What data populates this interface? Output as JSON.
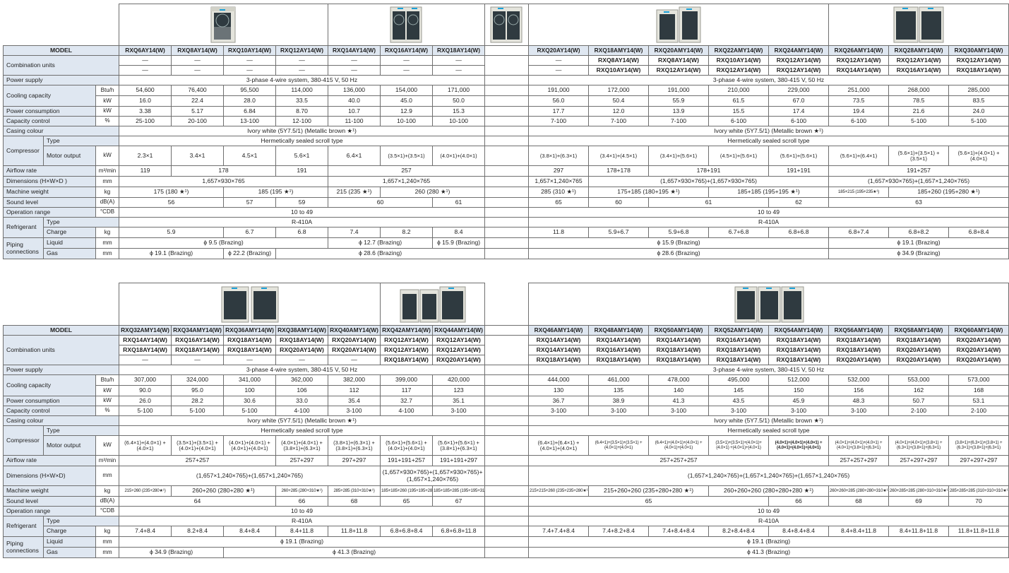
{
  "t1": {
    "models": [
      "RXQ6AY14(W)",
      "RXQ8AY14(W)",
      "RXQ10AY14(W)",
      "RXQ12AY14(W)",
      "RXQ14AY14(W)",
      "RXQ16AY14(W)",
      "RXQ18AY14(W)",
      "RXQ20AY14(W)",
      "RXQ18AMY14(W)",
      "RXQ20AMY14(W)",
      "RXQ22AMY14(W)",
      "RXQ24AMY14(W)",
      "RXQ26AMY14(W)",
      "RXQ28AMY14(W)",
      "RXQ30AMY14(W)"
    ],
    "comb1": [
      "—",
      "—",
      "—",
      "—",
      "—",
      "—",
      "—",
      "—",
      "RXQ8AY14(W)",
      "RXQ8AY14(W)",
      "RXQ10AY14(W)",
      "RXQ12AY14(W)",
      "RXQ12AY14(W)",
      "RXQ12AY14(W)",
      "RXQ12AY14(W)"
    ],
    "comb2": [
      "—",
      "—",
      "—",
      "—",
      "—",
      "—",
      "—",
      "—",
      "RXQ10AY14(W)",
      "RXQ12AY14(W)",
      "RXQ12AY14(W)",
      "RXQ12AY14(W)",
      "RXQ14AY14(W)",
      "RXQ16AY14(W)",
      "RXQ18AY14(W)"
    ],
    "power_supply_left": "3-phase 4-wire system, 380-415 V, 50 Hz",
    "power_supply_right": "3-phase 4-wire system, 380-415 V, 50 Hz",
    "cool_btu": [
      "54,600",
      "76,400",
      "95,500",
      "114,000",
      "136,000",
      "154,000",
      "171,000",
      "191,000",
      "172,000",
      "191,000",
      "210,000",
      "229,000",
      "251,000",
      "268,000",
      "285,000"
    ],
    "cool_kw": [
      "16.0",
      "22.4",
      "28.0",
      "33.5",
      "40.0",
      "45.0",
      "50.0",
      "56.0",
      "50.4",
      "55.9",
      "61.5",
      "67.0",
      "73.5",
      "78.5",
      "83.5"
    ],
    "power_kw": [
      "3.38",
      "5.17",
      "6.84",
      "8.70",
      "10.7",
      "12.9",
      "15.3",
      "17.7",
      "12.0",
      "13.9",
      "15.5",
      "17.4",
      "19.4",
      "21.6",
      "24.0"
    ],
    "capacity": [
      "25-100",
      "20-100",
      "13-100",
      "12-100",
      "11-100",
      "10-100",
      "10-100",
      "7-100",
      "7-100",
      "7-100",
      "6-100",
      "6-100",
      "6-100",
      "5-100",
      "5-100"
    ],
    "casing_left": "Ivory white (5Y7.5/1) (Metallic brown ★¹)",
    "casing_right": "Ivory white (5Y7.5/1) (Metallic brown ★¹)",
    "comp_type_left": "Hermetically sealed scroll type",
    "comp_type_right": "Hermetically sealed scroll type",
    "motor": [
      "2.3×1",
      "3.4×1",
      "4.5×1",
      "5.6×1",
      "6.4×1",
      "(3.5×1)+(3.5×1)",
      "(4.0×1)+(4.0×1)",
      "(3.8×1)+(6.3×1)",
      "(3.4×1)+(4.5×1)",
      "(3.4×1)+(5.6×1)",
      "(4.5×1)+(5.6×1)",
      "(5.6×1)+(5.6×1)",
      "(5.6×1)+(6.4×1)",
      "(5.6×1)+(3.5×1) +(3.5×1)",
      "(5.6×1)+(4.0×1) +(4.0×1)"
    ],
    "airflow": [
      "119",
      "178",
      "191",
      "257",
      "297",
      "178+178",
      "178+191",
      "191+191",
      "191+257"
    ],
    "dims": [
      "1,657×930×765",
      "1,657×1,240×765",
      "1,657×1,240×765",
      "(1,657×930×765)+(1,657×930×765)",
      "(1,657×930×765)+(1,657×1,240×765)"
    ],
    "weight": [
      "175 (180 ★¹)",
      "185 (195 ★¹)",
      "215 (235 ★¹)",
      "260 (280 ★¹)",
      "285 (310 ★¹)",
      "175+185 (180+195 ★¹)",
      "185+185 (195+195 ★¹)",
      "185+215 (195+235★¹)",
      "185+260 (195+280 ★¹)"
    ],
    "sound": [
      "56",
      "57",
      "59",
      "60",
      "61",
      "65",
      "60",
      "61",
      "62",
      "63"
    ],
    "op_left": "10 to 49",
    "op_right": "10 to 49",
    "ref_type_left": "R-410A",
    "ref_type_right": "R-410A",
    "charge": [
      "5.9",
      "6.7",
      "6.8",
      "7.4",
      "8.2",
      "8.4",
      "11.8",
      "5.9+6.7",
      "5.9+6.8",
      "6.7+6.8",
      "6.8+6.8",
      "6.8+7.4",
      "6.8+8.2",
      "6.8+8.4"
    ],
    "liquid": [
      "ϕ 9.5 (Brazing)",
      "ϕ 12.7 (Brazing)",
      "ϕ 15.9 (Brazing)",
      "ϕ 15.9 (Brazing)",
      "ϕ 19.1 (Brazing)"
    ],
    "gas": [
      "ϕ 19.1 (Brazing)",
      "ϕ 22.2 (Brazing)",
      "ϕ 28.6 (Brazing)",
      "ϕ 28.6 (Brazing)",
      "ϕ 34.9 (Brazing)"
    ]
  },
  "t2": {
    "models": [
      "RXQ32AMY14(W)",
      "RXQ34AMY14(W)",
      "RXQ36AMY14(W)",
      "RXQ38AMY14(W)",
      "RXQ40AMY14(W)",
      "RXQ42AMY14(W)",
      "RXQ44AMY14(W)",
      "RXQ46AMY14(W)",
      "RXQ48AMY14(W)",
      "RXQ50AMY14(W)",
      "RXQ52AMY14(W)",
      "RXQ54AMY14(W)",
      "RXQ56AMY14(W)",
      "RXQ58AMY14(W)",
      "RXQ60AMY14(W)"
    ],
    "comb1": [
      "RXQ14AY14(W)",
      "RXQ16AY14(W)",
      "RXQ18AY14(W)",
      "RXQ18AY14(W)",
      "RXQ20AY14(W)",
      "RXQ12AY14(W)",
      "RXQ12AY14(W)",
      "RXQ14AY14(W)",
      "RXQ14AY14(W)",
      "RXQ14AY14(W)",
      "RXQ16AY14(W)",
      "RXQ18AY14(W)",
      "RXQ18AY14(W)",
      "RXQ18AY14(W)",
      "RXQ20AY14(W)"
    ],
    "comb2": [
      "RXQ18AY14(W)",
      "RXQ18AY14(W)",
      "RXQ18AY14(W)",
      "RXQ20AY14(W)",
      "RXQ20AY14(W)",
      "RXQ12AY14(W)",
      "RXQ12AY14(W)",
      "RXQ14AY14(W)",
      "RXQ16AY14(W)",
      "RXQ18AY14(W)",
      "RXQ18AY14(W)",
      "RXQ18AY14(W)",
      "RXQ18AY14(W)",
      "RXQ20AY14(W)",
      "RXQ20AY14(W)"
    ],
    "comb3": [
      "—",
      "—",
      "—",
      "—",
      "—",
      "RXQ18AY14(W)",
      "RXQ20AY14(W)",
      "RXQ18AY14(W)",
      "RXQ18AY14(W)",
      "RXQ18AY14(W)",
      "RXQ18AY14(W)",
      "RXQ18AY14(W)",
      "RXQ20AY14(W)",
      "RXQ20AY14(W)",
      "RXQ20AY14(W)"
    ],
    "power_supply_left": "3-phase 4-wire system, 380-415 V, 50 Hz",
    "power_supply_right": "3-phase 4-wire system, 380-415 V, 50 Hz",
    "cool_btu": [
      "307,000",
      "324,000",
      "341,000",
      "362,000",
      "382,000",
      "399,000",
      "420,000",
      "444,000",
      "461,000",
      "478,000",
      "495,000",
      "512,000",
      "532,000",
      "553,000",
      "573,000"
    ],
    "cool_kw": [
      "90.0",
      "95.0",
      "100",
      "106",
      "112",
      "117",
      "123",
      "130",
      "135",
      "140",
      "145",
      "150",
      "156",
      "162",
      "168"
    ],
    "power_kw": [
      "26.0",
      "28.2",
      "30.6",
      "33.0",
      "35.4",
      "32.7",
      "35.1",
      "36.7",
      "38.9",
      "41.3",
      "43.5",
      "45.9",
      "48.3",
      "50.7",
      "53.1"
    ],
    "capacity": [
      "5-100",
      "5-100",
      "5-100",
      "4-100",
      "3-100",
      "4-100",
      "3-100",
      "3-100",
      "3-100",
      "3-100",
      "3-100",
      "3-100",
      "3-100",
      "2-100",
      "2-100"
    ],
    "casing_left": "Ivory white (5Y7.5/1) (Metallic brown ★¹)",
    "casing_right": "Ivory white (5Y7.5/1) (Metallic brown ★¹)",
    "comp_type_left": "Hermetically sealed scroll type",
    "comp_type_right": "Hermetically sealed scroll type",
    "motor": [
      "(6.4×1)+(4.0×1) +(4.0×1)",
      "(3.5×1)+(3.5×1) +(4.0×1)+(4.0×1)",
      "(4.0×1)+(4.0×1) +(4.0×1)+(4.0×1)",
      "(4.0×1)+(4.0×1) +(3.8×1)+(6.3×1)",
      "(3.8×1)+(6.3×1) +(3.8×1)+(6.3×1)",
      "(5.6×1)+(5.6×1) +(4.0×1)+(4.0×1)",
      "(5.6×1)+(5.6×1) +(3.8×1)+(6.3×1)",
      "(6.4×1)+(6.4×1) +(4.0×1)+(4.0×1)",
      "(6.4×1)+(3.5×1)+(3.5×1) +(4.0×1)+(4.0×1)",
      "(6.4×1)+(4.0×1)+(4.0×1) +(4.0×1)+(4.0×1)",
      "(3.5×1)+(3.5×1)+(4.0×1)+(4.0×1) +(4.0×1)+(4.0×1)",
      "(4.0×1)+(4.0×1)+(4.0×1) +(4.0×1)+(4.0×1)+(4.0×1)",
      "(4.0×1)+(4.0×1)+(4.0×1) +(4.0×1)+(3.8×1)+(6.3×1)",
      "(4.0×1)+(4.0×1)+(3.8×1) +(6.3×1)+(3.8×1)+(6.3×1)",
      "(3.8×1)+(6.3×1)+(3.8×1) +(6.3×1)+(3.8×1)+(6.3×1)"
    ],
    "airflow": [
      "257+257",
      "257+297",
      "297+297",
      "191+191+257",
      "191+191+297",
      "257+257+257",
      "257+257+297",
      "257+297+297",
      "297+297+297"
    ],
    "dims": [
      "(1,657×1,240×765)+(1,657×1,240×765)",
      "(1,657×930×765)+(1,657×930×765)+ (1,657×1,240×765)",
      "(1,657×1,240×765)+(1,657×1,240×765)+(1,657×1,240×765)"
    ],
    "weight": [
      "215+260 (235+280★¹)",
      "260+260 (280+280 ★¹)",
      "260+285 (280+310★¹)",
      "285+285 (310+310★¹)",
      "185+185+260 (195+195+280★¹)",
      "185+185+285 (195+195+310★¹)",
      "215+215+260 (235+235+280★¹)",
      "215+260+260 (235+280+280 ★¹)",
      "260+260+260 (280+280+280 ★¹)",
      "260+260+285 (280+280+310★¹)",
      "260+285+285 (280+310+310★¹)",
      "285+285+285 (310+310+310★¹)"
    ],
    "sound": [
      "64",
      "66",
      "68",
      "65",
      "67",
      "65",
      "66",
      "68",
      "69",
      "70"
    ],
    "op_left": "10 to 49",
    "op_right": "10 to 49",
    "ref_type_left": "R-410A",
    "ref_type_right": "R-410A",
    "charge": [
      "7.4+8.4",
      "8.2+8.4",
      "8.4+8.4",
      "8.4+11.8",
      "11.8+11.8",
      "6.8+6.8+8.4",
      "6.8+6.8+11.8",
      "7.4+7.4+8.4",
      "7.4+8.2+8.4",
      "7.4+8.4+8.4",
      "8.2+8.4+8.4",
      "8.4+8.4+8.4",
      "8.4+8.4+11.8",
      "8.4+11.8+11.8",
      "11.8+11.8+11.8"
    ],
    "liquid": [
      "ϕ 19.1 (Brazing)",
      "ϕ 19.1 (Brazing)"
    ],
    "gas": [
      "ϕ 34.9 (Brazing)",
      "ϕ 41.3 (Brazing)",
      "ϕ 41.3 (Brazing)"
    ]
  },
  "labels": {
    "model": "MODEL",
    "combination": "Combination units",
    "power_supply": "Power supply",
    "cooling": "Cooling capacity",
    "power_consumption": "Power consumption",
    "capacity_control": "Capacity control",
    "casing": "Casing colour",
    "compressor": "Compressor",
    "type": "Type",
    "motor": "Motor output",
    "airflow": "Airflow rate",
    "dimensions": "Dimensions (H×W×D )",
    "dimensions2": "Dimensions (H×W×D)",
    "weight": "Machine weight",
    "sound": "Sound level",
    "operation": "Operation range",
    "refrigerant": "Refrigerant",
    "charge": "Charge",
    "piping": "Piping connections",
    "liquid": "Liquid",
    "gas": "Gas"
  },
  "units": {
    "btu": "Btu/h",
    "kw": "kW",
    "pct": "%",
    "airflow": "m³/min",
    "mm": "mm",
    "kg": "kg",
    "dba": "dB(A)",
    "cdb": "°CDB"
  },
  "colors": {
    "header_fill": "#dfe7f1",
    "border": "#6f6f6f",
    "unit_body": "#e4e4dc",
    "fan_grille": "#2f3a40",
    "logo": "#1aa0d8"
  }
}
